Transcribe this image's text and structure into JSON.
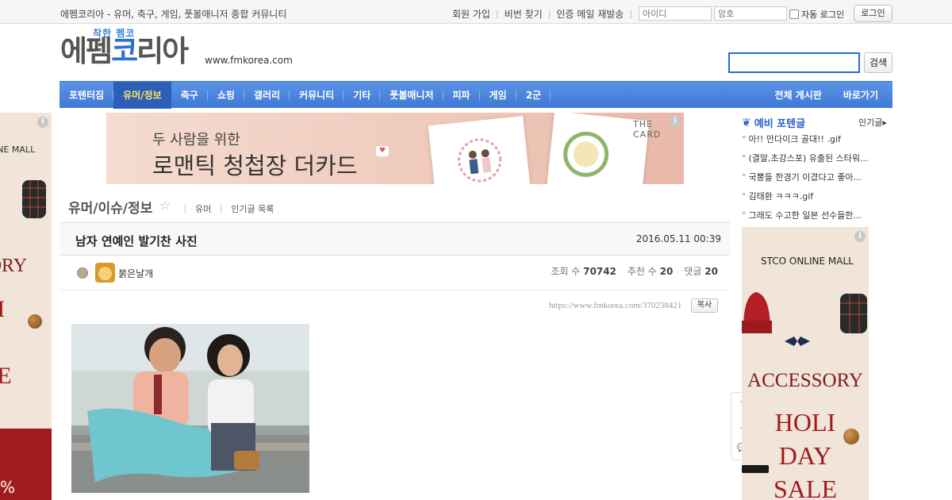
{
  "topbar": {
    "site_desc": "에펨코리아 - 유머, 축구, 게임, 풋볼매니저 종합 커뮤니티",
    "links": [
      "회원 가입",
      "비번 찾기",
      "인증 메일 재발송"
    ],
    "id_placeholder": "아이디",
    "pw_placeholder": "암호",
    "auto_login": "자동 로그인",
    "login_btn": "로그인"
  },
  "logo": {
    "tagline": "착한 펨코",
    "name_a": "에펨",
    "name_b": "코",
    "name_c": "리아",
    "url": "www.fmkorea.com"
  },
  "search": {
    "button": "검색"
  },
  "nav": {
    "items": [
      "포텐터짐",
      "유머/정보",
      "축구",
      "쇼핑",
      "갤러리",
      "커뮤니티",
      "기타",
      "풋볼매니저",
      "피파",
      "게임",
      "2군"
    ],
    "active_index": 1,
    "right_items": [
      "전체 게시판",
      "바로가기"
    ]
  },
  "banner": {
    "line1": "두 사람을 위한",
    "line2": "로맨틱 청첩장 더카드",
    "brand": "THE CARD"
  },
  "side_ad": {
    "brand": "STCO ONLINE MALL",
    "left_brand": "ONLINE MALL",
    "accessory": "ACCESSORY",
    "left_accessory": "SSORY",
    "holi": "HOLI",
    "day": "DAY",
    "sale": "SALE",
    "left_holi": "LI",
    "left_day": "Y",
    "left_sale": "LE",
    "left_percent": "%",
    "info": "i"
  },
  "board": {
    "title": "유머/이슈/정보",
    "links": [
      "유머",
      "인기글 목록"
    ]
  },
  "post": {
    "title": "남자 연예인 발기찬 사진",
    "date": "2016.05.11 00:39",
    "author": "붉은날개",
    "views_label": "조회 수",
    "views": "70742",
    "recommend_label": "추천 수",
    "recommend": "20",
    "comments_label": "댓글",
    "comments": "20",
    "permalink": "https://www.fmkorea.com/370238421",
    "copy": "복사"
  },
  "sidebar": {
    "title": "예비 포텐글",
    "more": "인기글",
    "items": [
      "아!! 만다이크 골대!! .gif",
      "(결말,초강스포) 유출된 스타워...",
      "국뽕들 한경기 이겼다고 좋아...",
      "김태환 ㅋㅋㅋ.gif",
      "그래도 수고한 일본 선수들한..."
    ]
  },
  "icons": {
    "star": "☆",
    "up": "↑",
    "down": "↓",
    "comment": "💬",
    "sidebar": "❦",
    "arrow": "▸"
  },
  "colors": {
    "nav": "#4a80dc",
    "accent": "#2b61c4",
    "nav_active_text": "#ffe45c"
  }
}
